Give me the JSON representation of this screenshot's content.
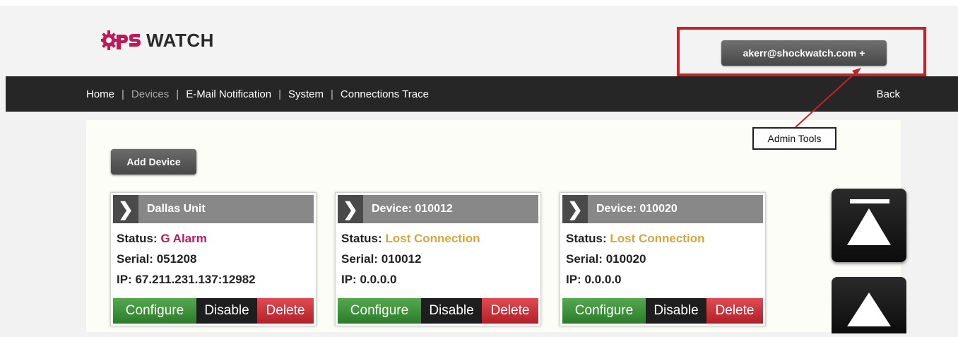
{
  "header": {
    "logo_text": "WATCH",
    "user_button_label": "akerr@shockwatch.com  +"
  },
  "nav": {
    "items": [
      {
        "label": "Home"
      },
      {
        "label": "Devices"
      },
      {
        "label": "E-Mail Notification"
      },
      {
        "label": "System"
      },
      {
        "label": "Connections Trace"
      }
    ],
    "separator": "|",
    "back_label": "Back"
  },
  "annotation": {
    "callout_label": "Admin Tools",
    "highlight_color": "#c5222a"
  },
  "toolbar": {
    "add_device_label": "Add Device"
  },
  "labels": {
    "status": "Status:",
    "serial": "Serial:",
    "ip": "IP:"
  },
  "actions": {
    "configure": "Configure",
    "disable": "Disable",
    "delete": "Delete"
  },
  "devices": [
    {
      "name": "Dallas Unit",
      "status": "G Alarm",
      "status_color": "#c1185a",
      "serial": "051208",
      "ip": "67.211.231.137:12982"
    },
    {
      "name": "Device: 010012",
      "status": "Lost Connection",
      "status_color": "#d4a63c",
      "serial": "010012",
      "ip": "0.0.0.0"
    },
    {
      "name": "Device: 010020",
      "status": "Lost Connection",
      "status_color": "#d4a63c",
      "serial": "010020",
      "ip": "0.0.0.0"
    }
  ],
  "icons": {
    "logo": "gear-logo-icon",
    "card_expand": "chevron-right-icon",
    "scroll_top": "scroll-to-top-icon",
    "scroll_up": "scroll-up-icon"
  }
}
